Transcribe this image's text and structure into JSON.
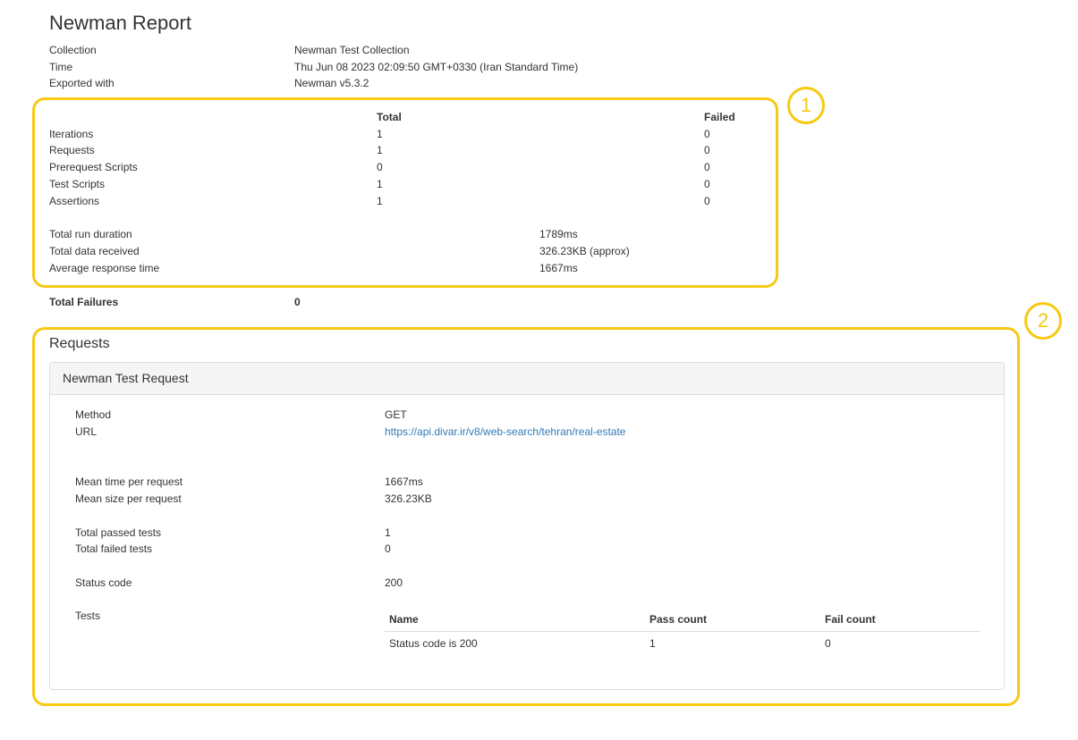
{
  "header": {
    "title": "Newman Report"
  },
  "meta": [
    {
      "label": "Collection",
      "value": "Newman Test Collection"
    },
    {
      "label": "Time",
      "value": "Thu Jun 08 2023 02:09:50 GMT+0330 (Iran Standard Time)"
    },
    {
      "label": "Exported with",
      "value": "Newman v5.3.2"
    }
  ],
  "summary": {
    "col_total": "Total",
    "col_failed": "Failed",
    "rows": [
      {
        "label": "Iterations",
        "total": "1",
        "failed": "0"
      },
      {
        "label": "Requests",
        "total": "1",
        "failed": "0"
      },
      {
        "label": "Prerequest Scripts",
        "total": "0",
        "failed": "0"
      },
      {
        "label": "Test Scripts",
        "total": "1",
        "failed": "0"
      },
      {
        "label": "Assertions",
        "total": "1",
        "failed": "0"
      }
    ],
    "run": [
      {
        "label": "Total run duration",
        "value": "1789ms"
      },
      {
        "label": "Total data received",
        "value": "326.23KB (approx)"
      },
      {
        "label": "Average response time",
        "value": "1667ms"
      }
    ],
    "failures_label": "Total Failures",
    "failures_value": "0"
  },
  "annotations": {
    "marker1": "1",
    "marker2": "2",
    "color": "#f6c913"
  },
  "requests": {
    "heading": "Requests",
    "panel_title": "Newman Test Request",
    "method_label": "Method",
    "method": "GET",
    "url_label": "URL",
    "url": "https://api.divar.ir/v8/web-search/tehran/real-estate",
    "mean_time_label": "Mean time per request",
    "mean_time": "1667ms",
    "mean_size_label": "Mean size per request",
    "mean_size": "326.23KB",
    "passed_label": "Total passed tests",
    "passed": "1",
    "failed_label": "Total failed tests",
    "failed": "0",
    "status_label": "Status code",
    "status": "200",
    "tests_label": "Tests",
    "tests_table": {
      "headers": [
        "Name",
        "Pass count",
        "Fail count"
      ],
      "rows": [
        [
          "Status code is 200",
          "1",
          "0"
        ]
      ]
    }
  },
  "colors": {
    "link": "#337ab7",
    "text": "#333333",
    "panel_header_bg": "#f5f5f5"
  }
}
